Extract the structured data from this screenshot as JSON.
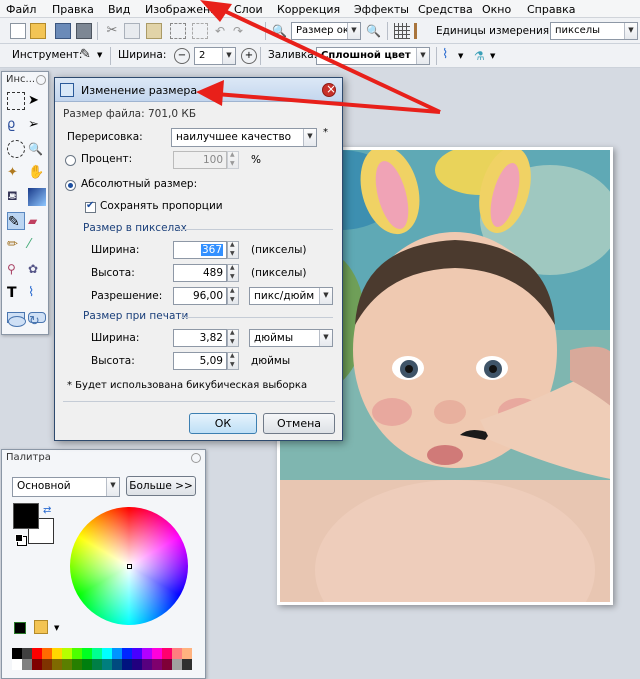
{
  "menu": [
    "Файл",
    "Правка",
    "Вид",
    "Изображение",
    "Слои",
    "Коррекция",
    "Эффекты",
    "Средства",
    "Окно",
    "Справка"
  ],
  "toolbar1": {
    "zoom_value": "Размер ок",
    "units_label": "Единицы измерения:",
    "units_value": "пикселы"
  },
  "toolbar2": {
    "tool_label": "Инструмент:",
    "width_label": "Ширина:",
    "width_value": "2",
    "fill_label": "Заливка:",
    "fill_value": "Сплошной цвет"
  },
  "tools_panel": {
    "title": "Инс..."
  },
  "dialog": {
    "title": "Изменение размера",
    "file_size": "Размер файла: 701,0 КБ",
    "resample_label": "Перерисовка:",
    "resample_value": "наилучшее качество",
    "resample_star": "*",
    "percent_label": "Процент:",
    "percent_value": "100",
    "percent_unit": "%",
    "absolute_label": "Абсолютный размер:",
    "keep_ratio_label": "Сохранять пропорции",
    "pixel_group": "Размер в пикселах",
    "px_width_label": "Ширина:",
    "px_width_value": "367",
    "px_width_unit": "(пикселы)",
    "px_height_label": "Высота:",
    "px_height_value": "489",
    "px_height_unit": "(пикселы)",
    "resolution_label": "Разрешение:",
    "resolution_value": "96,00",
    "resolution_unit": "пикс/дюйм",
    "print_group": "Размер при печати",
    "pr_width_label": "Ширина:",
    "pr_width_value": "3,82",
    "pr_width_unit": "дюймы",
    "pr_height_label": "Высота:",
    "pr_height_value": "5,09",
    "pr_height_unit": "дюймы",
    "note": "* Будет использована бикубическая выборка",
    "ok": "ОК",
    "cancel": "Отмена"
  },
  "palette": {
    "title": "Палитра",
    "mode_value": "Основной",
    "more_button": "Больше >>",
    "primary_color": "#000000",
    "secondary_color": "#ffffff"
  },
  "colors": {
    "arrow": "#e8201a",
    "accent": "#3c7fb1"
  }
}
